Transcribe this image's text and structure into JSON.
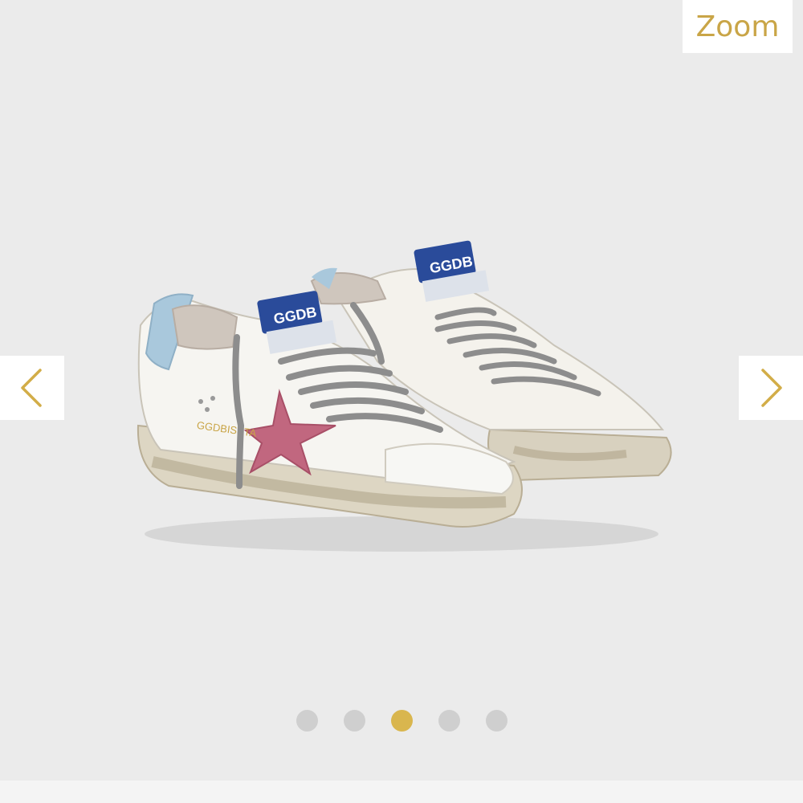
{
  "zoom": {
    "label": "Zoom"
  },
  "navigation": {
    "prev_icon": "chevron-left-icon",
    "next_icon": "chevron-right-icon"
  },
  "product_image": {
    "tongue_label": "GGDB",
    "side_lettering": "GGDBISSTA"
  },
  "carousel": {
    "total_slides": 5,
    "active_index": 2
  },
  "colors": {
    "accent_gold": "#d9b64e",
    "dot_inactive": "#cfcfcf",
    "zoom_text": "#c9a547",
    "star_pink": "#c1677f",
    "heel_blue": "#a9c8dc",
    "label_blue": "#2a4b9a"
  }
}
